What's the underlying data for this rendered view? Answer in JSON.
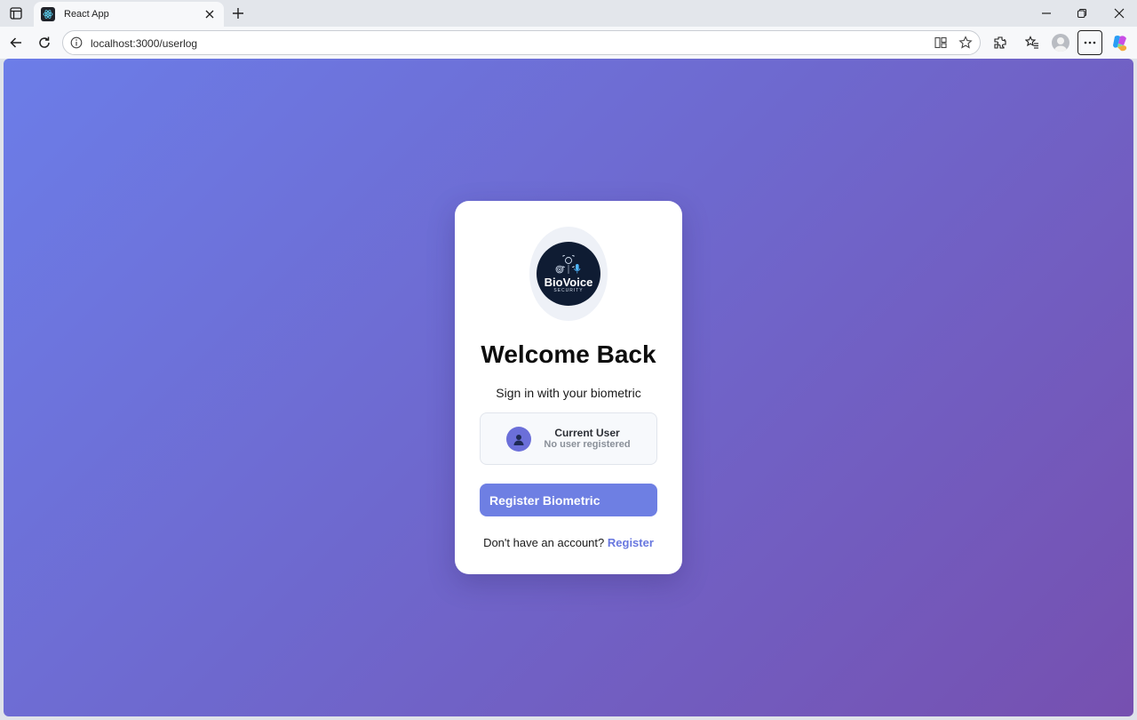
{
  "browser": {
    "tab_title": "React App",
    "url": "localhost:3000/userlog",
    "colors": {
      "chrome": "#f7f8fa",
      "tabstrip": "#e3e6eb"
    }
  },
  "page": {
    "colors": {
      "gradient_start": "#6c7de8",
      "gradient_end": "#7650b0",
      "accent": "#6e7fe3"
    },
    "logo": {
      "name": "BioVoice",
      "sub": "SECURITY"
    },
    "title": "Welcome Back",
    "subtitle": "Sign in with your biometric",
    "current_user": {
      "label": "Current User",
      "status": "No user registered"
    },
    "register_button": "Register Biometric",
    "footer": {
      "prompt": "Don't have an account?",
      "link": "Register"
    }
  }
}
